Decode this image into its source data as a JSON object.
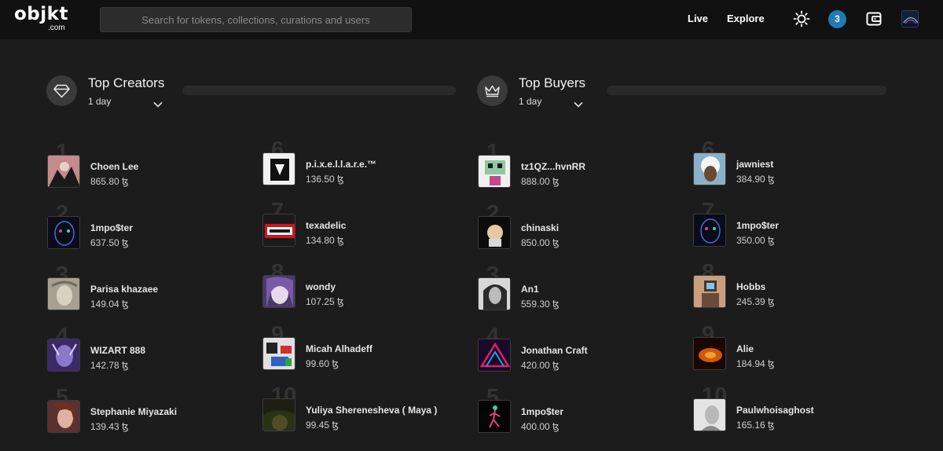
{
  "header": {
    "logo": "objkt",
    "logo_sub": ".com",
    "search_placeholder": "Search for tokens, collections, curations and users",
    "nav": [
      "Live",
      "Explore"
    ],
    "notification_count": "3",
    "icons": [
      "sun-icon",
      "wallet-icon",
      "profile-avatar"
    ]
  },
  "top_creators": {
    "title": "Top Creators",
    "period": "1 day",
    "icon": "diamond-icon",
    "entries": [
      {
        "rank": "1",
        "name": "Choen Lee",
        "volume": "865.80 ꜩ",
        "thumb": "#c58a8c"
      },
      {
        "rank": "2",
        "name": "1mpo$ter",
        "volume": "637.50 ꜩ",
        "thumb": "#141a2e"
      },
      {
        "rank": "3",
        "name": "Parisa khazaee",
        "volume": "149.04 ꜩ",
        "thumb": "#b0a89a"
      },
      {
        "rank": "4",
        "name": "WIZART 888",
        "volume": "142.78 ꜩ",
        "thumb": "#6a5a9a"
      },
      {
        "rank": "5",
        "name": "Stephanie Miyazaki",
        "volume": "139.43 ꜩ",
        "thumb": "#c89a90"
      },
      {
        "rank": "6",
        "name": "p.i.x.e.l.l.a.r.e.™",
        "volume": "136.50 ꜩ",
        "thumb": "#f0f0f0"
      },
      {
        "rank": "7",
        "name": "texadelic",
        "volume": "134.80 ꜩ",
        "thumb": "#c8101a"
      },
      {
        "rank": "8",
        "name": "wondy",
        "volume": "107.25 ꜩ",
        "thumb": "#8a7aa0"
      },
      {
        "rank": "9",
        "name": "Micah Alhadeff",
        "volume": "99.60 ꜩ",
        "thumb": "#d8d8d8"
      },
      {
        "rank": "10",
        "name": "Yuliya Sherenesheva ( Maya )",
        "volume": "99.45 ꜩ",
        "thumb": "#2a2a1c"
      }
    ]
  },
  "top_buyers": {
    "title": "Top Buyers",
    "period": "1 day",
    "icon": "crown-icon",
    "entries": [
      {
        "rank": "1",
        "name": "tz1QZ...hvnRR",
        "volume": "888.00 ꜩ",
        "thumb": "#8fc8a0"
      },
      {
        "rank": "2",
        "name": "chinaski",
        "volume": "850.00 ꜩ",
        "thumb": "#101010"
      },
      {
        "rank": "3",
        "name": "An1",
        "volume": "559.30 ꜩ",
        "thumb": "#9a9a9a"
      },
      {
        "rank": "4",
        "name": "Jonathan Craft",
        "volume": "420.00 ꜩ",
        "thumb": "#6a1a3a"
      },
      {
        "rank": "5",
        "name": "1mpo$ter",
        "volume": "400.00 ꜩ",
        "thumb": "#0a0a0a"
      },
      {
        "rank": "6",
        "name": "jawniest",
        "volume": "384.90 ꜩ",
        "thumb": "#9ab8c8"
      },
      {
        "rank": "7",
        "name": "1mpo$ter",
        "volume": "350.00 ꜩ",
        "thumb": "#141a2e"
      },
      {
        "rank": "8",
        "name": "Hobbs",
        "volume": "245.39 ꜩ",
        "thumb": "#c89878"
      },
      {
        "rank": "9",
        "name": "Alie",
        "volume": "184.94 ꜩ",
        "thumb": "#d06010"
      },
      {
        "rank": "10",
        "name": "Paulwhoisaghost",
        "volume": "165.16 ꜩ",
        "thumb": "#d8d8d8"
      }
    ]
  }
}
